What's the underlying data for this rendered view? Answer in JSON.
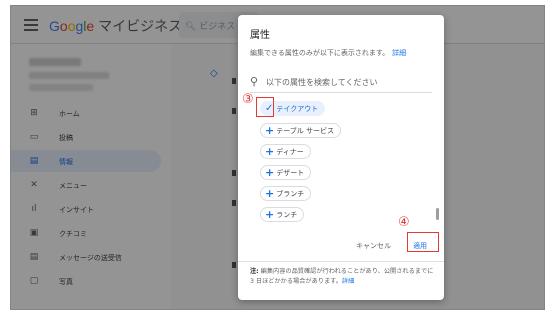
{
  "app": {
    "brand_google": "Google",
    "brand_suffix": " マイビジネス",
    "search_placeholder": "ビジネス"
  },
  "sidebar": {
    "items": [
      {
        "label": "ホーム",
        "icon": "⊞"
      },
      {
        "label": "投稿",
        "icon": "▭"
      },
      {
        "label": "情報",
        "icon": "▤"
      },
      {
        "label": "メニュー",
        "icon": "✕"
      },
      {
        "label": "インサイト",
        "icon": "ıl"
      },
      {
        "label": "クチコミ",
        "icon": "▣"
      },
      {
        "label": "メッセージの送受信",
        "icon": "▤"
      },
      {
        "label": "写真",
        "icon": "▢"
      }
    ]
  },
  "dialog": {
    "title": "属性",
    "description": "編集できる属性のみが以下に表示されます。",
    "details_link": "詳細",
    "search_placeholder": "以下の属性を検索してください",
    "chips": [
      {
        "label": "テイクアウト",
        "selected": true
      },
      {
        "label": "テーブル サービス",
        "selected": false
      },
      {
        "label": "ディナー",
        "selected": false
      },
      {
        "label": "デザート",
        "selected": false
      },
      {
        "label": "ブランチ",
        "selected": false
      },
      {
        "label": "ランチ",
        "selected": false
      }
    ],
    "cancel_label": "キャンセル",
    "apply_label": "適用",
    "note_prefix": "注:",
    "note_text": " 編集内容の品質確認が行われることがあり、公開されるまでに 3 日ほどかかる場合があります。",
    "note_link": "詳細"
  },
  "annotations": {
    "step3": "③",
    "step4": "④"
  },
  "colors": {
    "accent": "#1a73e8",
    "annotation": "#e53935"
  }
}
